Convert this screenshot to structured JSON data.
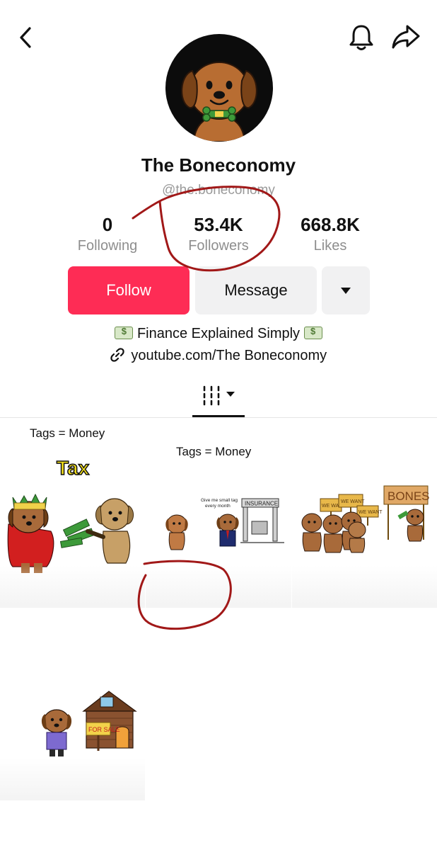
{
  "header": {
    "back_icon": "chevron-left-icon",
    "bell_icon": "bell-icon",
    "share_icon": "share-arrow-icon"
  },
  "profile": {
    "name": "The Boneconomy",
    "handle": "@the.boneconomy"
  },
  "stats": {
    "following": {
      "value": "0",
      "label": "Following"
    },
    "followers": {
      "value": "53.4K",
      "label": "Followers"
    },
    "likes": {
      "value": "668.8K",
      "label": "Likes"
    }
  },
  "actions": {
    "follow_label": "Follow",
    "message_label": "Message",
    "more_icon": "caret-down-icon"
  },
  "bio": {
    "text": "Finance Explained Simply",
    "link": "youtube.com/The Boneconomy"
  },
  "tabs": {
    "videos_icon": "grid-bars-icon"
  },
  "videos": [
    {
      "caption": "Tags = Money",
      "overlay": "Tax",
      "views": ""
    },
    {
      "caption": "Tags = Money",
      "label": "INSURANCE",
      "note": "Give me small tag every month",
      "views": ""
    },
    {
      "signs": [
        "WE WANT",
        "WE WANT",
        "WE WANT"
      ],
      "sign_big": "BONES",
      "views": ""
    },
    {
      "sign": "FOR SALE",
      "views": ""
    }
  ],
  "colors": {
    "follow_bg": "#fe2c55",
    "secondary_bg": "#f1f1f2",
    "annotation_red": "#a11818"
  }
}
